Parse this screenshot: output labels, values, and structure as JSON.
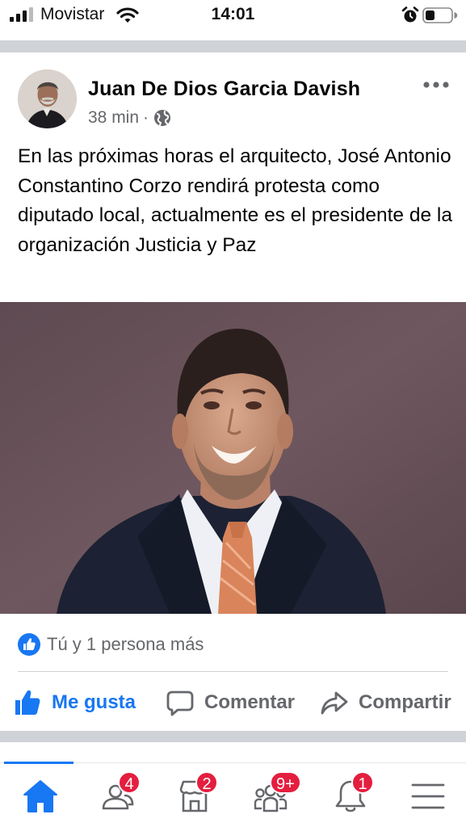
{
  "status_bar": {
    "carrier": "Movistar",
    "time": "14:01"
  },
  "post": {
    "author": "Juan De Dios Garcia Davish",
    "time_ago": "38 min",
    "separator": "·",
    "privacy_icon": "globe-icon",
    "more_icon": "more-horizontal-icon",
    "text": "En las próximas horas el arquitecto, José Antonio Constantino Corzo rendirá protesta como diputado local, actualmente es el presidente de la organización Justicia y Paz",
    "reactions_text": "Tú y 1 persona más"
  },
  "actions": {
    "like": "Me gusta",
    "comment": "Comentar",
    "share": "Compartir"
  },
  "nav": {
    "friends_badge": "4",
    "marketplace_badge": "2",
    "groups_badge": "9+",
    "notifications_badge": "1"
  },
  "colors": {
    "accent": "#1877f2",
    "badge": "#e41e3f",
    "secondary_text": "#65676b",
    "separator": "#cfd2d6"
  }
}
